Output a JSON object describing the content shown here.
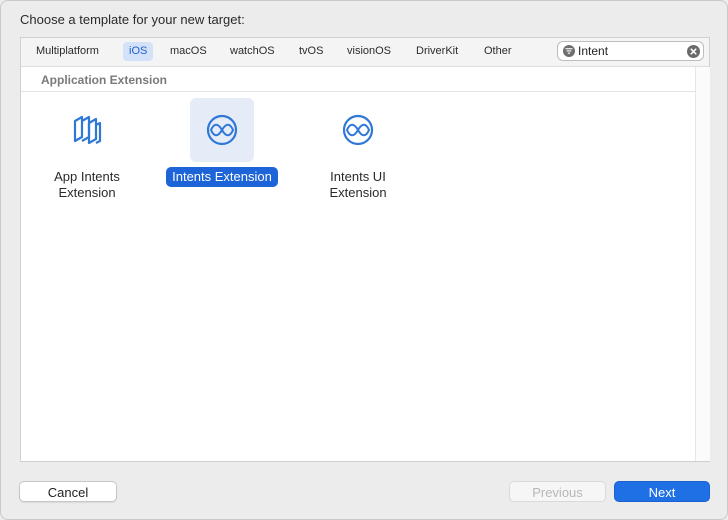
{
  "dialog": {
    "heading": "Choose a template for your new target:"
  },
  "tabs": [
    {
      "label": "Multiplatform",
      "active": false
    },
    {
      "label": "iOS",
      "active": true
    },
    {
      "label": "macOS",
      "active": false
    },
    {
      "label": "watchOS",
      "active": false
    },
    {
      "label": "tvOS",
      "active": false
    },
    {
      "label": "visionOS",
      "active": false
    },
    {
      "label": "DriverKit",
      "active": false
    },
    {
      "label": "Other",
      "active": false
    }
  ],
  "search": {
    "value": "Intent",
    "icon": "filter-icon",
    "clear_icon": "clear-icon"
  },
  "section": {
    "title": "Application Extension"
  },
  "templates": [
    {
      "label": "App Intents\nExtension",
      "icon": "app-intents-icon",
      "selected": false
    },
    {
      "label": "Intents Extension",
      "icon": "intents-icon",
      "selected": true
    },
    {
      "label": "Intents UI\nExtension",
      "icon": "intents-ui-icon",
      "selected": false
    }
  ],
  "buttons": {
    "cancel": "Cancel",
    "previous": "Previous",
    "next": "Next"
  },
  "colors": {
    "accent": "#1f6fe5",
    "icon_blue": "#2f78d8",
    "selection_bg": "#e5ecf8",
    "tab_active_bg": "#d3e2f9"
  }
}
